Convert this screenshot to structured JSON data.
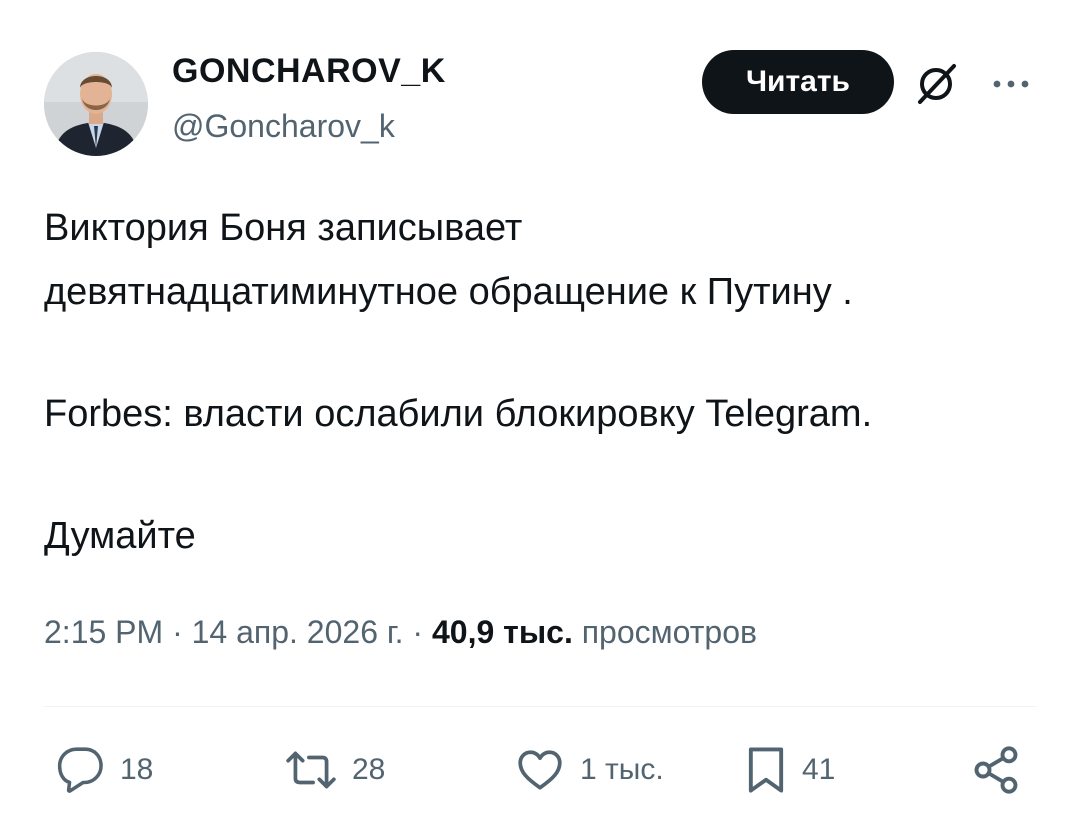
{
  "author": {
    "display_name": "GONCHAROV_K",
    "handle": "@Goncharov_k"
  },
  "follow_button_label": "Читать",
  "tweet": {
    "paragraphs": [
      [
        "Виктория Боня записывает",
        "девятнадцатиминутное обращение к Путину ."
      ],
      [
        "Forbes: власти ослабили блокировку Telegram."
      ],
      [
        "Думайте"
      ]
    ],
    "time": "2:15 PM",
    "separator": "·",
    "date": "14 апр. 2026 г.",
    "views_count": "40,9 тыс.",
    "views_label": "просмотров"
  },
  "actions": {
    "replies": "18",
    "reposts": "28",
    "likes": "1 тыс.",
    "bookmarks": "41"
  },
  "icons": {
    "reply": "reply-icon",
    "repost": "repost-icon",
    "like": "heart-icon",
    "bookmark": "bookmark-icon",
    "share": "share-icon",
    "grok": "grok-icon",
    "more": "more-icon"
  },
  "colors": {
    "text": "#0f1419",
    "secondary": "#536471",
    "button_bg": "#0f1419",
    "button_text": "#ffffff",
    "divider": "#eff3f4"
  }
}
